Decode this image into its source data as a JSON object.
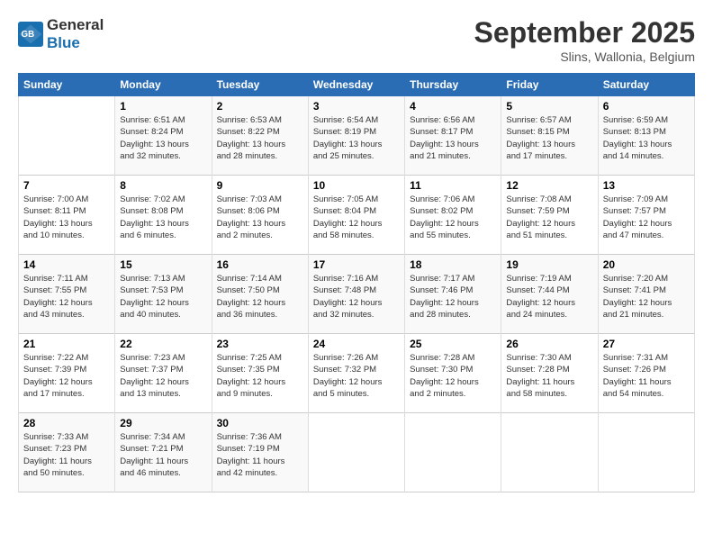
{
  "header": {
    "logo_line1": "General",
    "logo_line2": "Blue",
    "month": "September 2025",
    "location": "Slins, Wallonia, Belgium"
  },
  "weekdays": [
    "Sunday",
    "Monday",
    "Tuesday",
    "Wednesday",
    "Thursday",
    "Friday",
    "Saturday"
  ],
  "weeks": [
    [
      {
        "day": "",
        "detail": ""
      },
      {
        "day": "1",
        "detail": "Sunrise: 6:51 AM\nSunset: 8:24 PM\nDaylight: 13 hours\nand 32 minutes."
      },
      {
        "day": "2",
        "detail": "Sunrise: 6:53 AM\nSunset: 8:22 PM\nDaylight: 13 hours\nand 28 minutes."
      },
      {
        "day": "3",
        "detail": "Sunrise: 6:54 AM\nSunset: 8:19 PM\nDaylight: 13 hours\nand 25 minutes."
      },
      {
        "day": "4",
        "detail": "Sunrise: 6:56 AM\nSunset: 8:17 PM\nDaylight: 13 hours\nand 21 minutes."
      },
      {
        "day": "5",
        "detail": "Sunrise: 6:57 AM\nSunset: 8:15 PM\nDaylight: 13 hours\nand 17 minutes."
      },
      {
        "day": "6",
        "detail": "Sunrise: 6:59 AM\nSunset: 8:13 PM\nDaylight: 13 hours\nand 14 minutes."
      }
    ],
    [
      {
        "day": "7",
        "detail": "Sunrise: 7:00 AM\nSunset: 8:11 PM\nDaylight: 13 hours\nand 10 minutes."
      },
      {
        "day": "8",
        "detail": "Sunrise: 7:02 AM\nSunset: 8:08 PM\nDaylight: 13 hours\nand 6 minutes."
      },
      {
        "day": "9",
        "detail": "Sunrise: 7:03 AM\nSunset: 8:06 PM\nDaylight: 13 hours\nand 2 minutes."
      },
      {
        "day": "10",
        "detail": "Sunrise: 7:05 AM\nSunset: 8:04 PM\nDaylight: 12 hours\nand 58 minutes."
      },
      {
        "day": "11",
        "detail": "Sunrise: 7:06 AM\nSunset: 8:02 PM\nDaylight: 12 hours\nand 55 minutes."
      },
      {
        "day": "12",
        "detail": "Sunrise: 7:08 AM\nSunset: 7:59 PM\nDaylight: 12 hours\nand 51 minutes."
      },
      {
        "day": "13",
        "detail": "Sunrise: 7:09 AM\nSunset: 7:57 PM\nDaylight: 12 hours\nand 47 minutes."
      }
    ],
    [
      {
        "day": "14",
        "detail": "Sunrise: 7:11 AM\nSunset: 7:55 PM\nDaylight: 12 hours\nand 43 minutes."
      },
      {
        "day": "15",
        "detail": "Sunrise: 7:13 AM\nSunset: 7:53 PM\nDaylight: 12 hours\nand 40 minutes."
      },
      {
        "day": "16",
        "detail": "Sunrise: 7:14 AM\nSunset: 7:50 PM\nDaylight: 12 hours\nand 36 minutes."
      },
      {
        "day": "17",
        "detail": "Sunrise: 7:16 AM\nSunset: 7:48 PM\nDaylight: 12 hours\nand 32 minutes."
      },
      {
        "day": "18",
        "detail": "Sunrise: 7:17 AM\nSunset: 7:46 PM\nDaylight: 12 hours\nand 28 minutes."
      },
      {
        "day": "19",
        "detail": "Sunrise: 7:19 AM\nSunset: 7:44 PM\nDaylight: 12 hours\nand 24 minutes."
      },
      {
        "day": "20",
        "detail": "Sunrise: 7:20 AM\nSunset: 7:41 PM\nDaylight: 12 hours\nand 21 minutes."
      }
    ],
    [
      {
        "day": "21",
        "detail": "Sunrise: 7:22 AM\nSunset: 7:39 PM\nDaylight: 12 hours\nand 17 minutes."
      },
      {
        "day": "22",
        "detail": "Sunrise: 7:23 AM\nSunset: 7:37 PM\nDaylight: 12 hours\nand 13 minutes."
      },
      {
        "day": "23",
        "detail": "Sunrise: 7:25 AM\nSunset: 7:35 PM\nDaylight: 12 hours\nand 9 minutes."
      },
      {
        "day": "24",
        "detail": "Sunrise: 7:26 AM\nSunset: 7:32 PM\nDaylight: 12 hours\nand 5 minutes."
      },
      {
        "day": "25",
        "detail": "Sunrise: 7:28 AM\nSunset: 7:30 PM\nDaylight: 12 hours\nand 2 minutes."
      },
      {
        "day": "26",
        "detail": "Sunrise: 7:30 AM\nSunset: 7:28 PM\nDaylight: 11 hours\nand 58 minutes."
      },
      {
        "day": "27",
        "detail": "Sunrise: 7:31 AM\nSunset: 7:26 PM\nDaylight: 11 hours\nand 54 minutes."
      }
    ],
    [
      {
        "day": "28",
        "detail": "Sunrise: 7:33 AM\nSunset: 7:23 PM\nDaylight: 11 hours\nand 50 minutes."
      },
      {
        "day": "29",
        "detail": "Sunrise: 7:34 AM\nSunset: 7:21 PM\nDaylight: 11 hours\nand 46 minutes."
      },
      {
        "day": "30",
        "detail": "Sunrise: 7:36 AM\nSunset: 7:19 PM\nDaylight: 11 hours\nand 42 minutes."
      },
      {
        "day": "",
        "detail": ""
      },
      {
        "day": "",
        "detail": ""
      },
      {
        "day": "",
        "detail": ""
      },
      {
        "day": "",
        "detail": ""
      }
    ]
  ]
}
